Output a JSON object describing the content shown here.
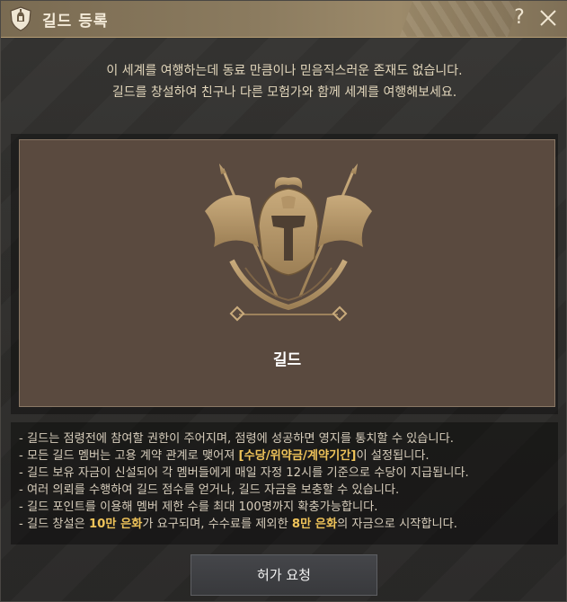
{
  "window": {
    "title": "길드 등록",
    "help_symbol": "?"
  },
  "intro": {
    "line1": "이 세계를 여행하는데 동료 만큼이나 믿음직스러운 존재도 없습니다.",
    "line2": "길드를 창설하여 친구나 다른 모험가와 함께 세계를 여행해보세요."
  },
  "card": {
    "label": "길드",
    "icon": "guild-crest-icon"
  },
  "info": {
    "items": [
      {
        "parts": [
          {
            "t": "- 길드는 점령전에 참여할 권한이 주어지며, 점령에 성공하면 영지를 통치할 수 있습니다."
          }
        ]
      },
      {
        "parts": [
          {
            "t": "- 모든 길드 멤버는 고용 계약 관계로 맺어져 "
          },
          {
            "t": "[수당/위약금/계약기간]",
            "hl": true
          },
          {
            "t": "이 설정됩니다."
          }
        ]
      },
      {
        "parts": [
          {
            "t": "- 길드 보유 자금이 신설되어 각 멤버들에게 매일 자정 12시를 기준으로 수당이 지급됩니다."
          }
        ]
      },
      {
        "parts": [
          {
            "t": "- 여러 의뢰를 수행하여 길드 점수를 얻거나, 길드 자금을 보충할 수 있습니다."
          }
        ]
      },
      {
        "parts": [
          {
            "t": "- 길드 포인트를 이용해 멤버 제한 수를 최대 100명까지 확충가능합니다."
          }
        ]
      },
      {
        "parts": [
          {
            "t": "- 길드 창설은 "
          },
          {
            "t": "10만 은화",
            "hl": true
          },
          {
            "t": "가 요구되며, 수수료를 제외한 "
          },
          {
            "t": "8만 은화",
            "hl": true
          },
          {
            "t": "의 자금으로 시작합니다."
          }
        ]
      }
    ],
    "highlight_color": "#f0c45a"
  },
  "actions": {
    "request_label": "허가 요청"
  }
}
